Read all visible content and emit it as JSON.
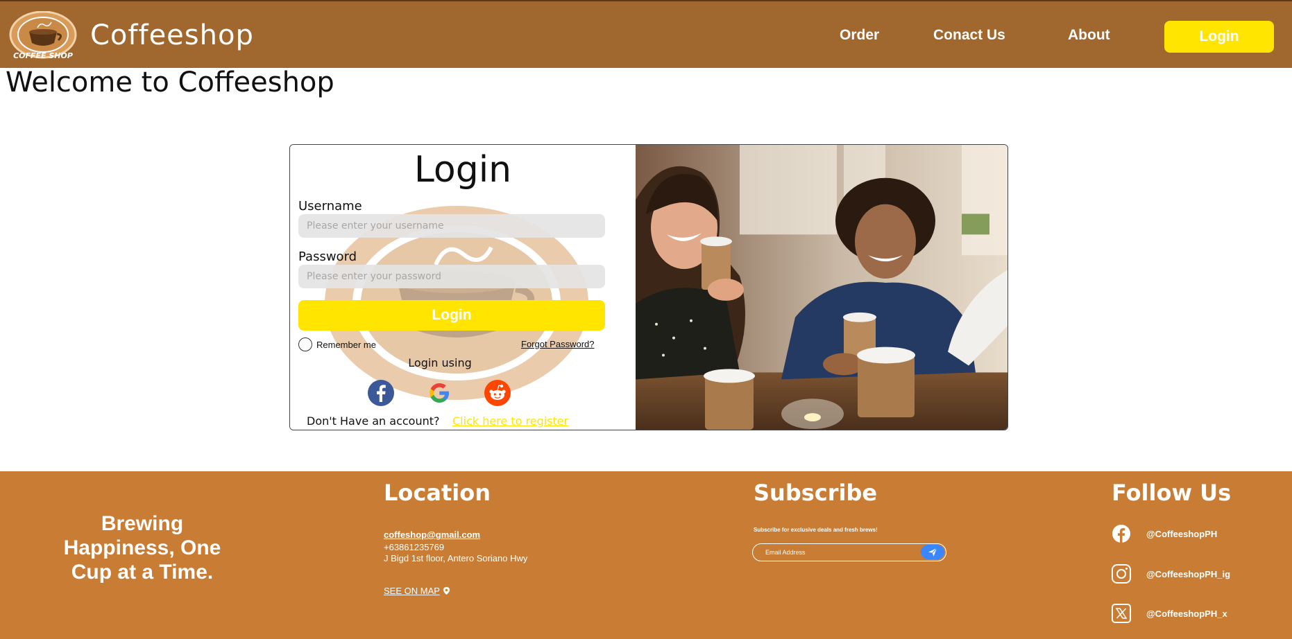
{
  "header": {
    "brand": "Coffeeshop",
    "logo_text": "COFFEE SHOP",
    "nav": {
      "order": "Order",
      "contact": "Conact Us",
      "about": "About"
    },
    "login_button": "Login"
  },
  "welcome": "Welcome to Coffeeshop",
  "login_card": {
    "title": "Login",
    "username_label": "Username",
    "username_placeholder": "Please enter your username",
    "password_label": "Password",
    "password_placeholder": "Please enter your password",
    "submit": "Login",
    "remember": "Remember me",
    "forgot": "Forgot Password?",
    "login_using": "Login using",
    "no_account": "Don't Have an account?",
    "register": "Click here to register"
  },
  "footer": {
    "slogan": "Brewing Happiness, One Cup at a Time.",
    "location": {
      "heading": "Location",
      "email": "coffeshop@gmail.com",
      "phone": "+63861235769",
      "address": "J Bigd 1st floor, Antero Soriano Hwy",
      "map": "SEE ON MAP"
    },
    "subscribe": {
      "heading": "Subscribe",
      "note": "Subscribe for exclusive deals and fresh brews!",
      "placeholder": "Email Address"
    },
    "follow": {
      "heading": "Follow Us",
      "facebook": "@CoffeeshopPH",
      "instagram": "@CoffeeshopPH_ig",
      "x": "@CoffeeshopPH_x"
    }
  },
  "colors": {
    "header_bg": "#a0672f",
    "footer_bg": "#c97c33",
    "accent_yellow": "#ffe500",
    "send_blue": "#3a86ff"
  }
}
